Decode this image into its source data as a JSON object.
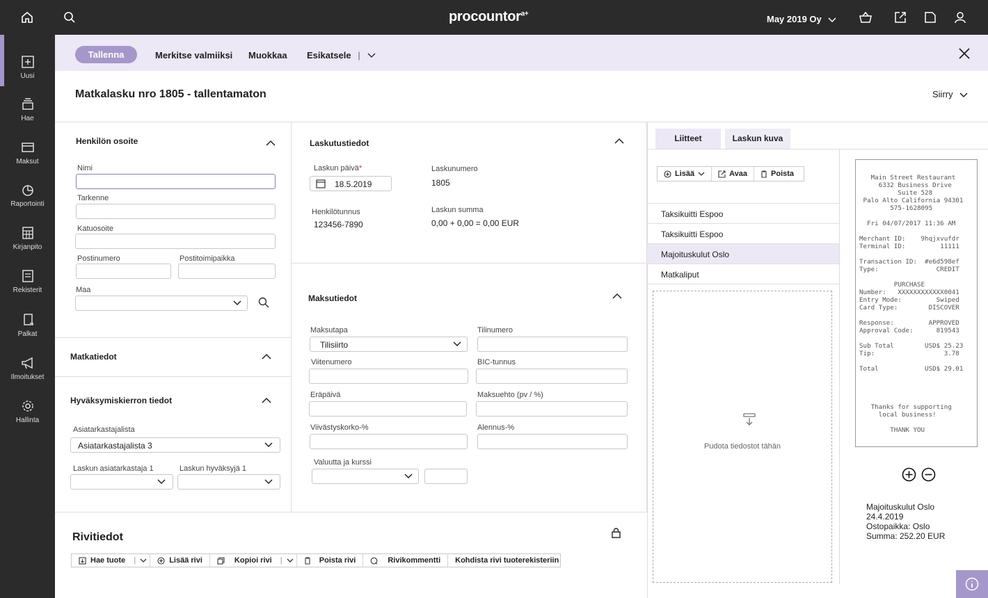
{
  "app": {
    "brand": "procountor",
    "brand_sup": "a+",
    "company": "May 2019 Oy"
  },
  "sidebar": {
    "items": [
      {
        "label": "Uusi"
      },
      {
        "label": "Hae"
      },
      {
        "label": "Maksut"
      },
      {
        "label": "Raportointi"
      },
      {
        "label": "Kirjanpito"
      },
      {
        "label": "Rekisterit"
      },
      {
        "label": "Palkat"
      },
      {
        "label": "Ilmoitukset"
      },
      {
        "label": "Hallinta"
      }
    ]
  },
  "actions": {
    "save": "Tallenna",
    "mark_ready": "Merkitse valmiiksi",
    "edit": "Muokkaa",
    "preview": "Esikatsele"
  },
  "page": {
    "title": "Matkalasku nro 1805 - tallentamaton",
    "goto": "Siirry"
  },
  "address": {
    "title": "Henkilön osoite",
    "name_label": "Nimi",
    "name_value": "",
    "extra_label": "Tarkenne",
    "street_label": "Katuosoite",
    "zip_label": "Postinumero",
    "city_label": "Postitoimipaikka",
    "country_label": "Maa"
  },
  "travel": {
    "title": "Matkatiedot"
  },
  "approval": {
    "title": "Hyväksymiskierron tiedot",
    "list_label": "Asiatarkastajalista",
    "list_value": "Asiatarkastajalista 3",
    "checker_label": "Laskun asiatarkastaja 1",
    "approver_label": "Laskun hyväksyjä 1"
  },
  "billing": {
    "title": "Laskutustiedot",
    "date_label": "Laskun päivä",
    "date_required": "*",
    "date_value": "18.5.2019",
    "number_label": "Laskunumero",
    "number_value": "1805",
    "ssn_label": "Henkilötunnus",
    "ssn_value": "123456-7890",
    "sum_label": "Laskun summa",
    "sum_value": "0,00 + 0,00 = 0,00 EUR"
  },
  "payment": {
    "title": "Maksutiedot",
    "method_label": "Maksutapa",
    "method_value": "Tilisiirto",
    "account_label": "Tilinumero",
    "ref_label": "Viitenumero",
    "bic_label": "BIC-tunnus",
    "due_label": "Eräpäivä",
    "terms_label": "Maksuehto (pv / %)",
    "interest_label": "Viivästyskorko-%",
    "discount_label": "Alennus-%",
    "currency_label": "Valuutta ja kurssi"
  },
  "rows": {
    "title": "Rivitiedot",
    "toolbar": [
      "Hae tuote",
      "Lisää rivi",
      "Kopioi rivi",
      "Poista rivi",
      "Rivikommentti",
      "Kohdista rivi tuoterekisteriin"
    ]
  },
  "attachments": {
    "tabs": [
      "Liitteet",
      "Laskun kuva"
    ],
    "toolbar": {
      "add": "Lisää",
      "open": "Avaa",
      "delete": "Poista"
    },
    "files": [
      "Taksikuitti Espoo",
      "Taksikuitti Espoo",
      "Majoituskulut Oslo",
      "Matkaliput"
    ],
    "selected_index": 2,
    "drop_text": "Pudota tiedostot tähän"
  },
  "receipt": {
    "text": "   Main Street Restaurant\n     6332 Business Drive\n          Suite 528\n Palo Alto California 94301\n        575-1628095\n\n  Fri 04/07/2017 11:36 AM\n\nMerchant ID:    9hqjxvufdr\nTerminal ID:         11111\n\nTransaction ID:  #e6d598ef\nType:               CREDIT\n\n         PURCHASE\nNumber:   XXXXXXXXXXXX0041\nEntry Mode:         Swiped\nCard Type:        DISCOVER\n\nResponse:         APPROVED\nApproval Code:      819543\n\nSub Total        USD$ 25.23\nTip:                  3.78\n\nTotal            USD$ 29.01\n\n\n\n\n   Thanks for supporting\n     local business!\n\n        THANK YOU",
    "caption_title": "Majoituskulut Oslo",
    "caption_date": "24.4.2019",
    "caption_place": "Ostopaikka: Oslo",
    "caption_sum": "Summa: 252.20 EUR"
  }
}
